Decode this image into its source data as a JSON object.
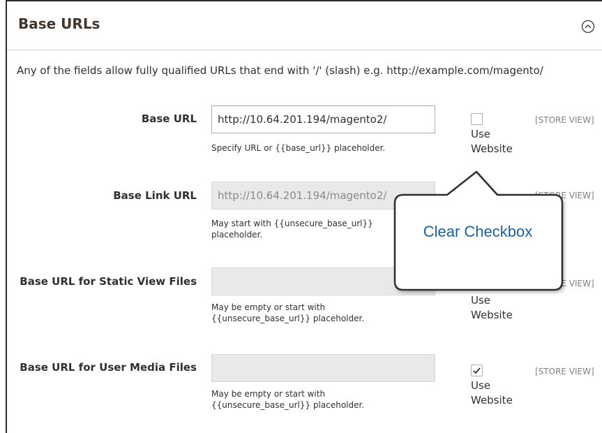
{
  "section": {
    "title": "Base URLs",
    "collapse_icon": "chevron-up-circle-icon",
    "note": "Any of the fields allow fully qualified URLs that end with '/' (slash) e.g. http://example.com/magento/"
  },
  "fields": [
    {
      "label": "Base URL",
      "value": "http://10.64.201.194/magento2/",
      "placeholder": "",
      "disabled": false,
      "hint": "Specify URL or {{base_url}} placeholder.",
      "use_website_checked": false,
      "use_website_label": "Use Website",
      "scope": "[STORE VIEW]"
    },
    {
      "label": "Base Link URL",
      "value": "http://10.64.201.194/magento2/",
      "placeholder": "",
      "disabled": true,
      "hint": "May start with {{unsecure_base_url}} placeholder.",
      "use_website_checked": true,
      "use_website_label": "Use Website",
      "scope": "[STORE VIEW]"
    },
    {
      "label": "Base URL for Static View Files",
      "value": "",
      "placeholder": "",
      "disabled": true,
      "hint": "May be empty or start with {{unsecure_base_url}} placeholder.",
      "use_website_checked": true,
      "use_website_label": "Use Website",
      "scope": "[STORE VIEW]"
    },
    {
      "label": "Base URL for User Media Files",
      "value": "",
      "placeholder": "",
      "disabled": true,
      "hint": "May be empty or start with {{unsecure_base_url}} placeholder.",
      "use_website_checked": true,
      "use_website_label": "Use Website",
      "scope": "[STORE VIEW]"
    }
  ],
  "callout": {
    "text": "Clear Checkbox"
  },
  "colors": {
    "callout_text": "#1f5f93",
    "title": "#41362f",
    "disabled_input": "#e9e9e9"
  }
}
